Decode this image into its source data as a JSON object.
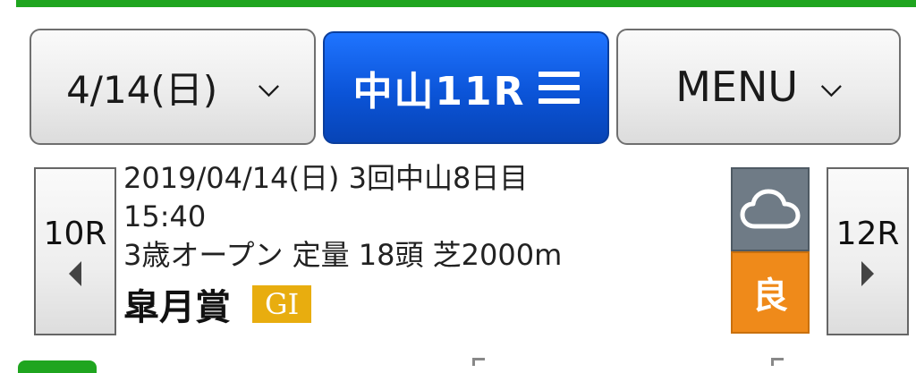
{
  "header": {
    "date_label": "4/14(日)",
    "race_label": "中山11R",
    "menu_label": "MENU"
  },
  "nav": {
    "prev_label": "10R",
    "next_label": "12R"
  },
  "race": {
    "date_line": "2019/04/14(日) 3回中山8日目",
    "time": "15:40",
    "conditions": "3歳オープン 定量 18頭 芝2000m",
    "name": "皐月賞",
    "grade": "GI",
    "going": "良"
  },
  "icons": {
    "date_chevron": "chevron-down-icon",
    "menu_chevron": "chevron-down-icon",
    "race_menu": "hamburger-icon",
    "weather": "cloud-icon",
    "prev": "triangle-left-icon",
    "next": "triangle-right-icon"
  },
  "colors": {
    "accent_green": "#1fa51f",
    "primary_blue": "#0b54d8",
    "grade_gold": "#e8ad0f",
    "weather_gray": "#6f7b86",
    "going_orange": "#ef8a1a"
  }
}
